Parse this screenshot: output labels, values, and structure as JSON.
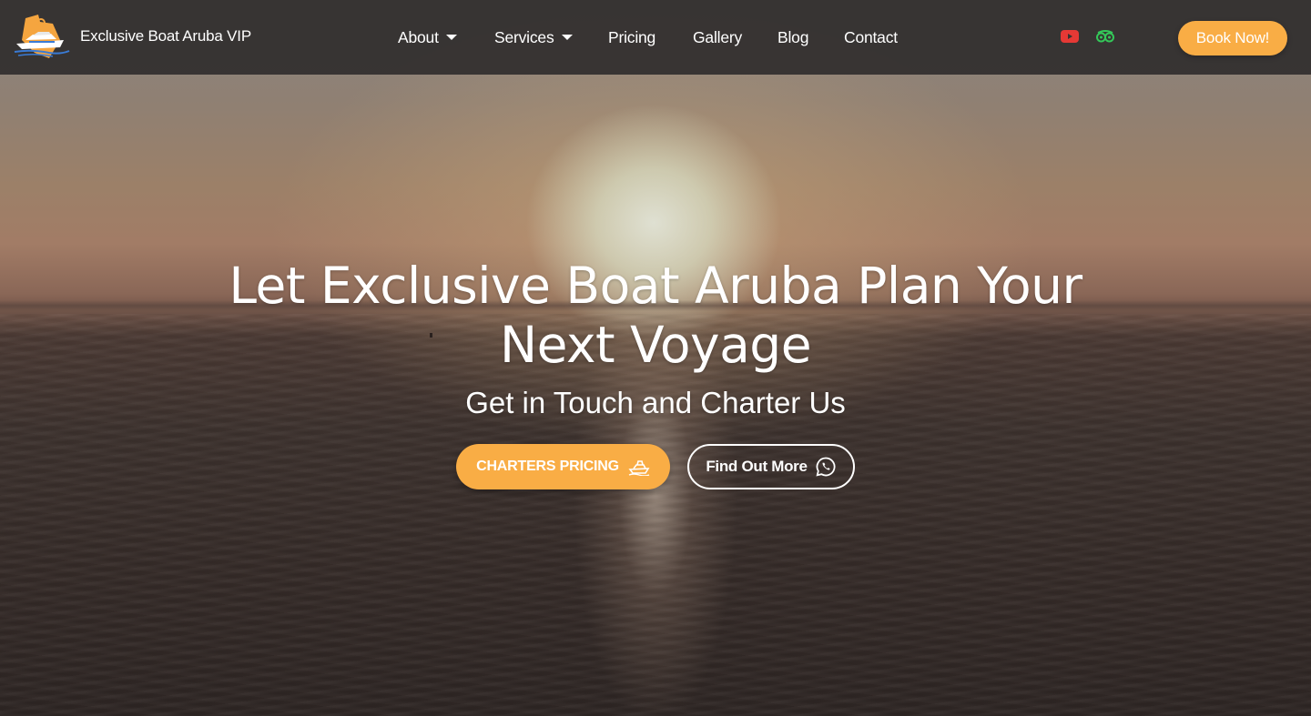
{
  "header": {
    "brand_name": "Exclusive Boat Aruba VIP",
    "logo_icon": "yacht-logo-icon",
    "nav": [
      {
        "label": "About",
        "has_dropdown": true
      },
      {
        "label": "Services",
        "has_dropdown": true
      },
      {
        "label": "Pricing",
        "has_dropdown": false
      },
      {
        "label": "Gallery",
        "has_dropdown": false
      },
      {
        "label": "Blog",
        "has_dropdown": false
      },
      {
        "label": "Contact",
        "has_dropdown": false
      }
    ],
    "social": [
      {
        "icon": "youtube-icon",
        "color": "#e53935"
      },
      {
        "icon": "tripadvisor-icon",
        "color": "#34c759"
      }
    ],
    "book_label": "Book Now!"
  },
  "hero": {
    "title": "Let Exclusive Boat Aruba Plan Your Next Voyage",
    "subtitle": "Get in Touch and Charter Us",
    "primary_button": {
      "label": "CHARTERS PRICING",
      "icon": "boat-icon"
    },
    "secondary_button": {
      "label": "Find Out More",
      "icon": "whatsapp-icon"
    }
  },
  "colors": {
    "accent": "#f9ad45",
    "header_bg": "#353231",
    "text": "#ffffff"
  }
}
